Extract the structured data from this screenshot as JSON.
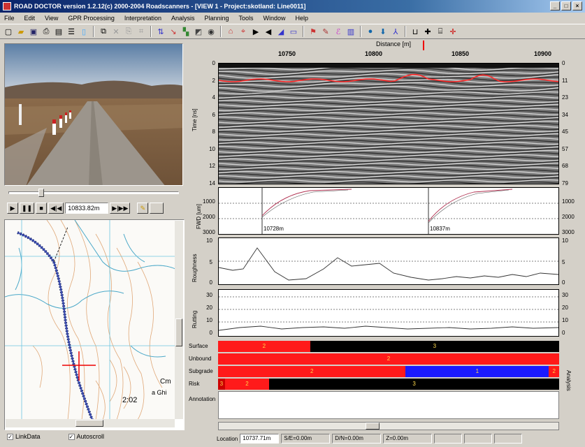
{
  "window": {
    "title": "ROAD DOCTOR version 1.2.12(c) 2000-2004 Roadscanners - [VIEW 1 - Project:skotland: Line0011]"
  },
  "menu": [
    "File",
    "Edit",
    "View",
    "GPR Processing",
    "Interpretation",
    "Analysis",
    "Planning",
    "Tools",
    "Window",
    "Help"
  ],
  "toolbar_icons": [
    "new-icon",
    "open-icon",
    "save-icon",
    "print-icon",
    "preview-icon",
    "settings-icon",
    "copy-icon",
    "cut-icon",
    "paste-icon",
    "undo-icon",
    "zoom-icon",
    "arrow-icon",
    "measure-icon",
    "chart-icon",
    "filter-icon",
    "marker-icon",
    "home-icon",
    "pointer-icon",
    "flag-icon",
    "layers-icon",
    "grid-icon",
    "edit-icon",
    "globe-icon",
    "pin-icon",
    "gauge-icon",
    "split-icon",
    "move-icon",
    "add-icon",
    "cross-icon"
  ],
  "video_controls": {
    "position_value": "10833.82m",
    "play_label": "▶",
    "pause_label": "❚❚",
    "stop_label": "■",
    "back_label": "◀|◀",
    "forward_label": "▶|▶▶",
    "slider_fraction": 0.18
  },
  "map": {
    "labels": [
      "Cm",
      "a  Ghi",
      "2:02"
    ]
  },
  "checkboxes": [
    {
      "label": "LinkData",
      "checked": true
    },
    {
      "label": "Autoscroll",
      "checked": true
    }
  ],
  "distance": {
    "axis_label": "Distance [m]",
    "ticks": [
      "10750",
      "10800",
      "10850",
      "10900"
    ],
    "cursor_fraction": 0.6
  },
  "gpr": {
    "ylabel": "Time [ns]",
    "left_ticks": [
      "0",
      "2",
      "4",
      "6",
      "8",
      "10",
      "12",
      "14"
    ],
    "right_ticks": [
      "0",
      "11",
      "23",
      "34",
      "45",
      "57",
      "68",
      "79"
    ]
  },
  "fwd": {
    "ylabel": "FWD [um]",
    "ticks": [
      "1000",
      "2000",
      "3000"
    ],
    "markers": [
      "10728m",
      "10837m"
    ]
  },
  "roughness": {
    "ylabel": "Roughness",
    "ticks": [
      "10",
      "5",
      "0"
    ]
  },
  "rutting": {
    "ylabel": "Rutting",
    "ticks": [
      "30",
      "20",
      "10",
      "0"
    ]
  },
  "layers": [
    {
      "name": "Surface",
      "segments": [
        {
          "start": 0,
          "end": 0.27,
          "color": "#ff1a1a",
          "label": "2"
        },
        {
          "start": 0.27,
          "end": 1,
          "color": "#000000",
          "label": "3"
        }
      ]
    },
    {
      "name": "Unbound",
      "segments": [
        {
          "start": 0,
          "end": 1,
          "color": "#ff1a1a",
          "label": "2"
        }
      ]
    },
    {
      "name": "Subgrade",
      "segments": [
        {
          "start": 0,
          "end": 0.55,
          "color": "#ff1a1a",
          "label": "2"
        },
        {
          "start": 0.55,
          "end": 0.97,
          "color": "#1a1aff",
          "label": "1"
        },
        {
          "start": 0.97,
          "end": 1,
          "color": "#ff1a1a",
          "label": "2"
        }
      ]
    },
    {
      "name": "Risk",
      "segments": [
        {
          "start": 0,
          "end": 0.02,
          "color": "#cc0000",
          "label": "3"
        },
        {
          "start": 0.02,
          "end": 0.15,
          "color": "#ff1a1a",
          "label": "2"
        },
        {
          "start": 0.15,
          "end": 1,
          "color": "#000000",
          "label": "3"
        }
      ]
    },
    {
      "name": "Annotation",
      "segments": []
    }
  ],
  "status": {
    "location_label": "Location",
    "location_value": "10737.71m",
    "s_value": "S/E=0.00m",
    "d_value": "D/N=0.00m",
    "z_value": "Z=0.00m"
  },
  "side_label": "Analysis"
}
